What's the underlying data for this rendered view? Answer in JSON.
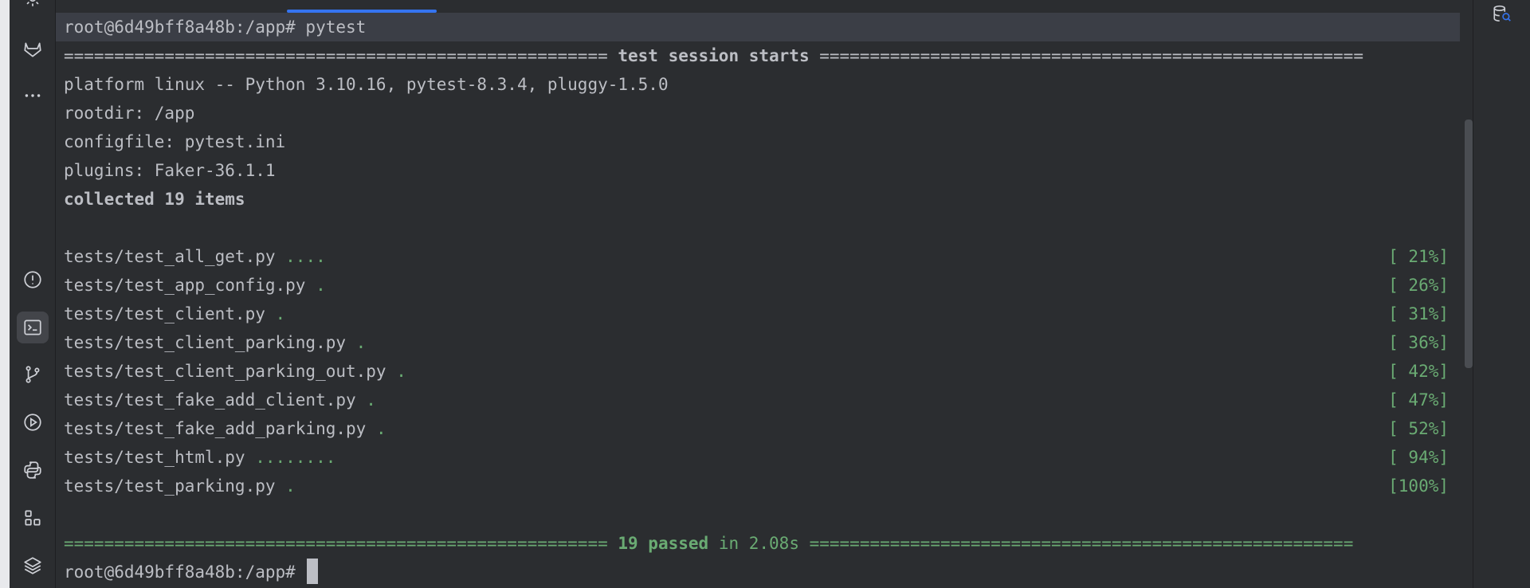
{
  "terminal": {
    "lines": [
      {
        "text": "root@6d49bff8a48b:/app# pytest"
      },
      {
        "left": "====================================================== ",
        "title": "test session starts",
        "right": " ======================================================"
      },
      {
        "text": "platform linux -- Python 3.10.16, pytest-8.3.4, pluggy-1.5.0"
      },
      {
        "text": "rootdir: /app"
      },
      {
        "text": "configfile: pytest.ini"
      },
      {
        "text": "plugins: Faker-36.1.1"
      },
      {
        "text": "collected 19 items"
      },
      {
        "file": "tests/test_all_get.py ",
        "dots": "....",
        "pct": "[ 21%]"
      },
      {
        "file": "tests/test_app_config.py ",
        "dots": ".",
        "pct": "[ 26%]"
      },
      {
        "file": "tests/test_client.py ",
        "dots": ".",
        "pct": "[ 31%]"
      },
      {
        "file": "tests/test_client_parking.py ",
        "dots": ".",
        "pct": "[ 36%]"
      },
      {
        "file": "tests/test_client_parking_out.py ",
        "dots": ".",
        "pct": "[ 42%]"
      },
      {
        "file": "tests/test_fake_add_client.py ",
        "dots": ".",
        "pct": "[ 47%]"
      },
      {
        "file": "tests/test_fake_add_parking.py ",
        "dots": ".",
        "pct": "[ 52%]"
      },
      {
        "file": "tests/test_html.py ",
        "dots": "........",
        "pct": "[ 94%]"
      },
      {
        "file": "tests/test_parking.py ",
        "dots": ".",
        "pct": "[100%]"
      },
      {
        "left": "====================================================== ",
        "passed": "19 passed",
        "rest": " in 2.08s",
        "right": " ======================================================"
      },
      {
        "text": "root@6d49bff8a48b:/app# "
      }
    ]
  },
  "toolbar": {
    "icons": [
      "settings-icon",
      "gitlab-icon",
      "more-icon",
      "problems-icon",
      "terminal-icon",
      "git-icon",
      "run-icon",
      "python-packages-icon",
      "structure-icon",
      "layers-icon"
    ]
  },
  "right_toolbar": {
    "icons": [
      "database-icon"
    ]
  },
  "colors": {
    "background": "#2b2d30",
    "text": "#bcbec4",
    "pass": "#6aab73",
    "accent": "#3574f0"
  }
}
